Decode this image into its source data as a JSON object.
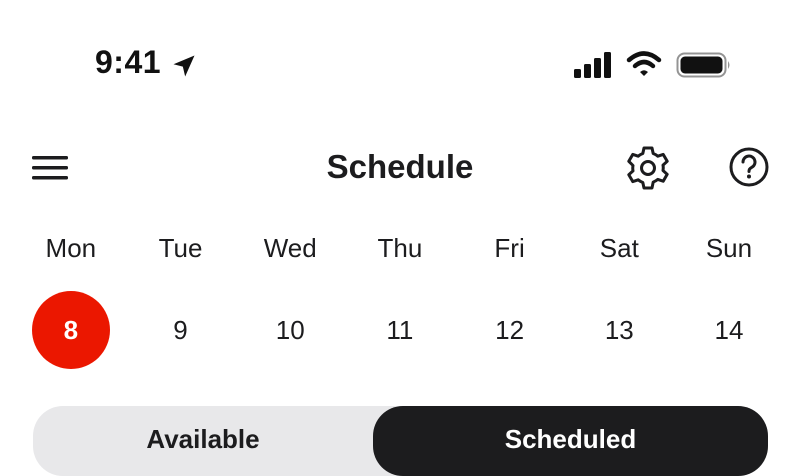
{
  "status_bar": {
    "time": "9:41",
    "icons": [
      "location-arrow-icon",
      "cellular-signal-icon",
      "wifi-icon",
      "battery-icon"
    ]
  },
  "header": {
    "title": "Schedule",
    "left_icon": "menu-icon",
    "right_icons": [
      "gear-icon",
      "help-icon"
    ]
  },
  "week": {
    "days": [
      {
        "name": "Mon",
        "date": "8",
        "selected": true
      },
      {
        "name": "Tue",
        "date": "9",
        "selected": false
      },
      {
        "name": "Wed",
        "date": "10",
        "selected": false
      },
      {
        "name": "Thu",
        "date": "11",
        "selected": false
      },
      {
        "name": "Fri",
        "date": "12",
        "selected": false
      },
      {
        "name": "Sat",
        "date": "13",
        "selected": false
      },
      {
        "name": "Sun",
        "date": "14",
        "selected": false
      }
    ]
  },
  "segments": {
    "available_label": "Available",
    "scheduled_label": "Scheduled",
    "active": "Scheduled"
  },
  "colors": {
    "accent": "#eb1700",
    "segment_active_bg": "#1c1c1e",
    "segment_bg": "#e8e8ea"
  }
}
